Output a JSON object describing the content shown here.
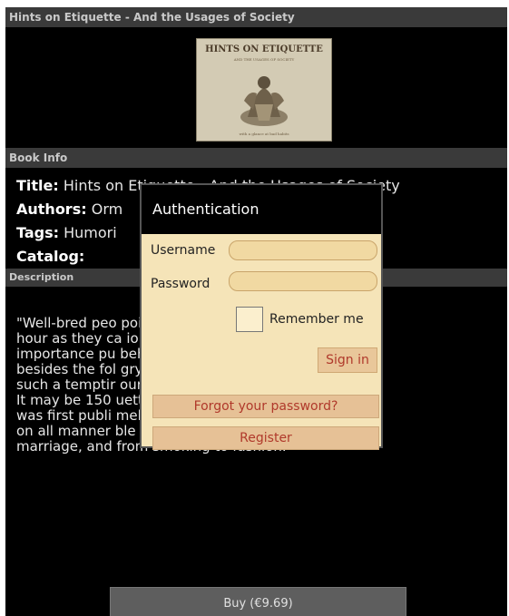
{
  "header": {
    "title": "Hints on Etiquette - And the Usages of Society"
  },
  "cover": {
    "title": "HINTS ON ETIQUETTE",
    "subtitle": "AND THE USAGES OF SOCIETY",
    "footer": "with a glance at bad habits"
  },
  "book_info": {
    "section_label": "Book Info",
    "title_label": "Title:",
    "title_value": "Hints on Etiquette - And the Usages of Society",
    "authors_label": "Authors:",
    "authors_value": "Orm",
    "tags_label": "Tags:",
    "tags_value": "Humori",
    "catalog_label": "Catalog:"
  },
  "description": {
    "section_label": "Description",
    "lines": [
      "\"Well-bred peo                                   pointed dinner",
      "hour as they ca                                    ion of",
      "importance pu                                     behind time;",
      "besides the fol                                    gry people",
      "such a temptir                                     our foibles.\"",
      "It may be 150                                     uette bible",
      "was first publi                                    meless advice",
      "on all manner                                     ble to",
      "marriage, and from smoking to fashion."
    ]
  },
  "buy": {
    "label": "Buy (€9.69)"
  },
  "auth_dialog": {
    "title": "Authentication",
    "username_label": "Username",
    "username_value": "",
    "password_label": "Password",
    "password_value": "",
    "remember_label": "Remember me",
    "signin_label": "Sign in",
    "forgot_label": "Forgot your password?",
    "register_label": "Register"
  }
}
